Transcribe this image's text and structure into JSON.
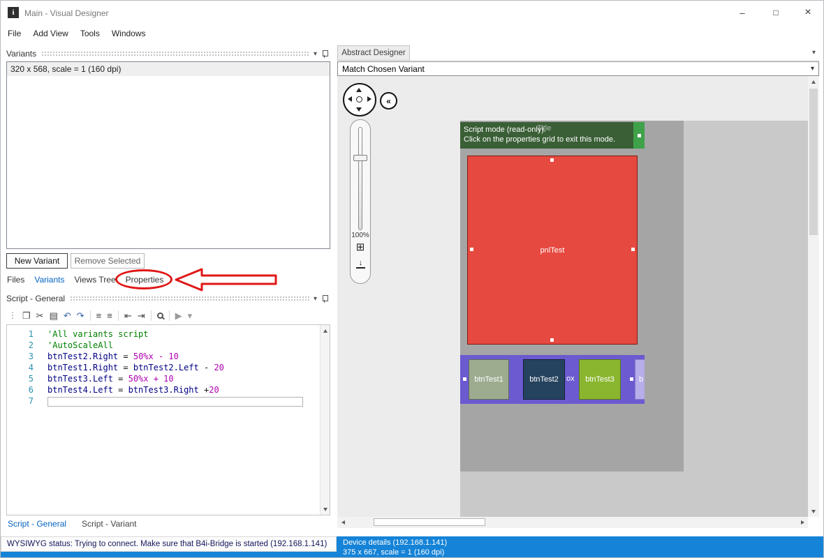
{
  "window": {
    "app_icon": "i",
    "title": "Main - Visual Designer",
    "minimize": "–",
    "maximize": "□",
    "close": "×"
  },
  "menu": {
    "items": [
      {
        "label": "File"
      },
      {
        "label": "Add View"
      },
      {
        "label": "Tools"
      },
      {
        "label": "Windows"
      }
    ]
  },
  "icons": {
    "dropdown": "▾",
    "collapse": "«",
    "grid": "⊞",
    "import_arrow": "↓"
  },
  "variants": {
    "header": "Variants",
    "rows": [
      {
        "label": "320 x 568, scale = 1 (160 dpi)"
      }
    ],
    "new_button": "New Variant",
    "remove_button": "Remove Selected"
  },
  "left_tabs": {
    "items": [
      {
        "label": "Files"
      },
      {
        "label": "Variants"
      },
      {
        "label": "Views Tree"
      },
      {
        "label": "Properties"
      }
    ],
    "active": "Variants"
  },
  "script": {
    "header": "Script - General",
    "toolbar": [
      {
        "name": "grip",
        "glyph": "⋮"
      },
      {
        "name": "copy",
        "glyph": "❐"
      },
      {
        "name": "cut",
        "glyph": "✂"
      },
      {
        "name": "paste",
        "glyph": "▤"
      },
      {
        "name": "undo",
        "glyph": "↶"
      },
      {
        "name": "redo",
        "glyph": "↷"
      },
      {
        "name": "comment",
        "glyph": "≡"
      },
      {
        "name": "uncomment",
        "glyph": "≡"
      },
      {
        "name": "outdent",
        "glyph": "⇤"
      },
      {
        "name": "indent",
        "glyph": "⇥"
      },
      {
        "name": "run",
        "glyph": "▶"
      },
      {
        "name": "overflow",
        "glyph": "▾"
      }
    ],
    "lines": [
      {
        "num": "1",
        "segs": [
          {
            "t": "'All variants script",
            "c": "comment"
          }
        ]
      },
      {
        "num": "2",
        "segs": [
          {
            "t": "'AutoScaleAll",
            "c": "comment"
          }
        ]
      },
      {
        "num": "3",
        "segs": [
          {
            "t": "btnTest2.Right",
            "c": "ident"
          },
          {
            "t": " = ",
            "c": "op"
          },
          {
            "t": "50%x - 10",
            "c": "num"
          }
        ]
      },
      {
        "num": "4",
        "segs": [
          {
            "t": "btnTest1.Right",
            "c": "ident"
          },
          {
            "t": " = ",
            "c": "op"
          },
          {
            "t": "btnTest2.Left",
            "c": "ident"
          },
          {
            "t": " - ",
            "c": "op"
          },
          {
            "t": "20",
            "c": "num"
          }
        ]
      },
      {
        "num": "5",
        "segs": [
          {
            "t": "btnTest3.Left",
            "c": "ident"
          },
          {
            "t": " = ",
            "c": "op"
          },
          {
            "t": "50%x + 10",
            "c": "num"
          }
        ]
      },
      {
        "num": "6",
        "segs": [
          {
            "t": "btnTest4.Left",
            "c": "ident"
          },
          {
            "t": " = ",
            "c": "op"
          },
          {
            "t": "btnTest3.Right",
            "c": "ident"
          },
          {
            "t": " +",
            "c": "op"
          },
          {
            "t": "20",
            "c": "num"
          }
        ]
      },
      {
        "num": "7",
        "segs": [],
        "edit_line": true
      }
    ],
    "bottom_tabs": [
      {
        "label": "Script - General",
        "active": true
      },
      {
        "label": "Script - Variant",
        "active": false
      }
    ]
  },
  "statusbar": {
    "wysiwyg": "WYSIWYG status: Trying to connect. Make sure that B4i-Bridge is started (192.168.1.141)"
  },
  "designer": {
    "tab": "Abstract Designer",
    "variant_combo": "Match Chosen Variant",
    "zoom": "100%",
    "overlay": {
      "line1": "Script mode (read-only).",
      "line2": "Click on the properties grid to exit this mode."
    },
    "ghost_title": "Title",
    "panel_label": "pnlTest",
    "views": [
      {
        "label": "btnTest1"
      },
      {
        "label": "btnTest2"
      },
      {
        "label": "btnTest3"
      },
      {
        "label": "b"
      }
    ],
    "ghost_label": "ox",
    "device_details": "Device details (192.168.1.141)",
    "device_variant": "375 x 667, scale = 1 (160 dpi)"
  },
  "colors": {
    "status_blue": "#1583d7",
    "overlay_green": "#31592d",
    "overlay_handle_green": "#3fa24a",
    "panel_red": "#e6493f",
    "bar_purple": "#6b5ad0",
    "btn1_sage": "#9dab8f",
    "btn2_navy": "#25425e",
    "btn3_green": "#8ab62f",
    "btn4_lavender": "#b6ade9",
    "annotation_red": "#e01616",
    "active_tab_blue": "#0563c1",
    "comment_green": "#008000",
    "number_magenta": "#b000b0",
    "identifier_navy": "#000083",
    "line_number_teal": "#2b91af"
  }
}
